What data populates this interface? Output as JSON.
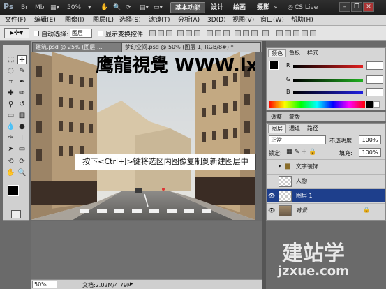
{
  "app": {
    "logo": "Ps",
    "zoom": "50%",
    "workspaces": [
      "基本功能",
      "设计",
      "绘画",
      "摄影"
    ],
    "cs_live": "CS Live"
  },
  "menu": [
    "文件(F)",
    "编辑(E)",
    "图像(I)",
    "图层(L)",
    "选择(S)",
    "滤镜(T)",
    "分析(A)",
    "3D(D)",
    "视图(V)",
    "窗口(W)",
    "帮助(H)"
  ],
  "options": {
    "auto_select_label": "自动选择:",
    "auto_select_value": "图层",
    "show_transform_label": "显示变换控件"
  },
  "tabs": [
    {
      "label": "建筑.psd @ 25% (图层 ..."
    },
    {
      "label": "梦幻空间.psd @ 50% (图层 1, RGB/8#) *"
    }
  ],
  "callout": "按下<Ctrl+J>键将选区内图像复制到新建图层中",
  "watermark_top": "鹰龍視覺 WWW.lxh.NET",
  "watermark_bottom": {
    "brand": "建站学",
    "url": "jzxue.com"
  },
  "color_panel": {
    "tabs": [
      "颜色",
      "色板",
      "样式"
    ],
    "channels": [
      {
        "label": "R",
        "value": "",
        "color": "#e02020"
      },
      {
        "label": "G",
        "value": "",
        "color": "#20b020"
      },
      {
        "label": "B",
        "value": "",
        "color": "#2020e0"
      }
    ]
  },
  "adjust_tabs": [
    "调整",
    "蒙版"
  ],
  "layers_panel": {
    "tabs": [
      "图层",
      "通道",
      "路径"
    ],
    "blend_mode": "正常",
    "opacity_label": "不透明度:",
    "opacity": "100%",
    "lock_label": "锁定:",
    "fill_label": "填充:",
    "fill": "100%",
    "layers": [
      {
        "name": "文字装饰",
        "type": "group",
        "visible": false
      },
      {
        "name": "人物",
        "type": "layer",
        "visible": false
      },
      {
        "name": "图层 1",
        "type": "layer",
        "visible": true,
        "selected": true
      },
      {
        "name": "背景",
        "type": "background",
        "visible": true,
        "locked": true
      }
    ]
  },
  "status": {
    "zoom": "50%",
    "doc": "文档:2.02M/4.79M"
  }
}
